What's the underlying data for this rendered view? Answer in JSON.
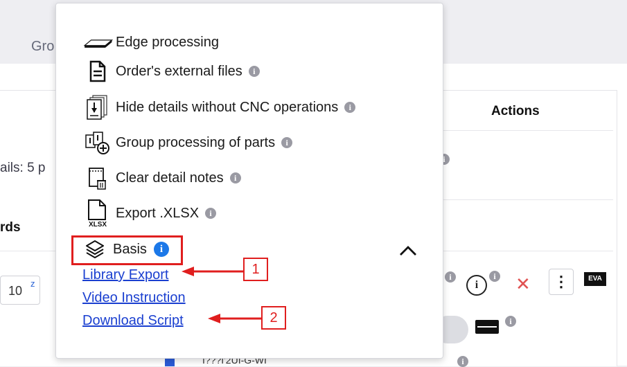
{
  "background": {
    "tab_partial": "Gro",
    "actions_header": "Actions",
    "details_partial": "ails: 5 p",
    "column_partial": "rds",
    "quantity_value": "10",
    "quantity_unit": "z",
    "bottom_partial": "I???I'2UI-G-WI"
  },
  "menu": {
    "items": [
      {
        "label": "Edge processing",
        "icon": "edge-icon",
        "info": false
      },
      {
        "label": "Order's external files",
        "icon": "file-icon",
        "info": true
      },
      {
        "label": "Hide details without CNC operations",
        "icon": "cnc-details-icon",
        "info": true
      },
      {
        "label": "Group processing of parts",
        "icon": "group-processing-icon",
        "info": true
      },
      {
        "label": "Clear detail notes",
        "icon": "clear-notes-icon",
        "info": true
      },
      {
        "label": "Export .XLSX",
        "icon": "xlsx-icon",
        "info": true
      }
    ],
    "basis": {
      "label": "Basis",
      "icon": "layers-icon",
      "expanded": true
    },
    "basis_links": [
      "Library Export",
      "Video Instruction",
      "Download Script"
    ],
    "xlsx_icon_text": "XLSX",
    "info_glyph": "i"
  },
  "annotations": {
    "callout_1": "1",
    "callout_2": "2",
    "color": "#e01e1e"
  },
  "actions_row": {
    "info_glyph": "i",
    "delete_glyph": "✕",
    "menu_glyph": "⋮",
    "badge": "EVA"
  },
  "colors": {
    "link": "#1a3fd0",
    "info_blue": "#1c78e8",
    "info_gray": "#9a9aa3",
    "highlight_red": "#e01e1e"
  }
}
